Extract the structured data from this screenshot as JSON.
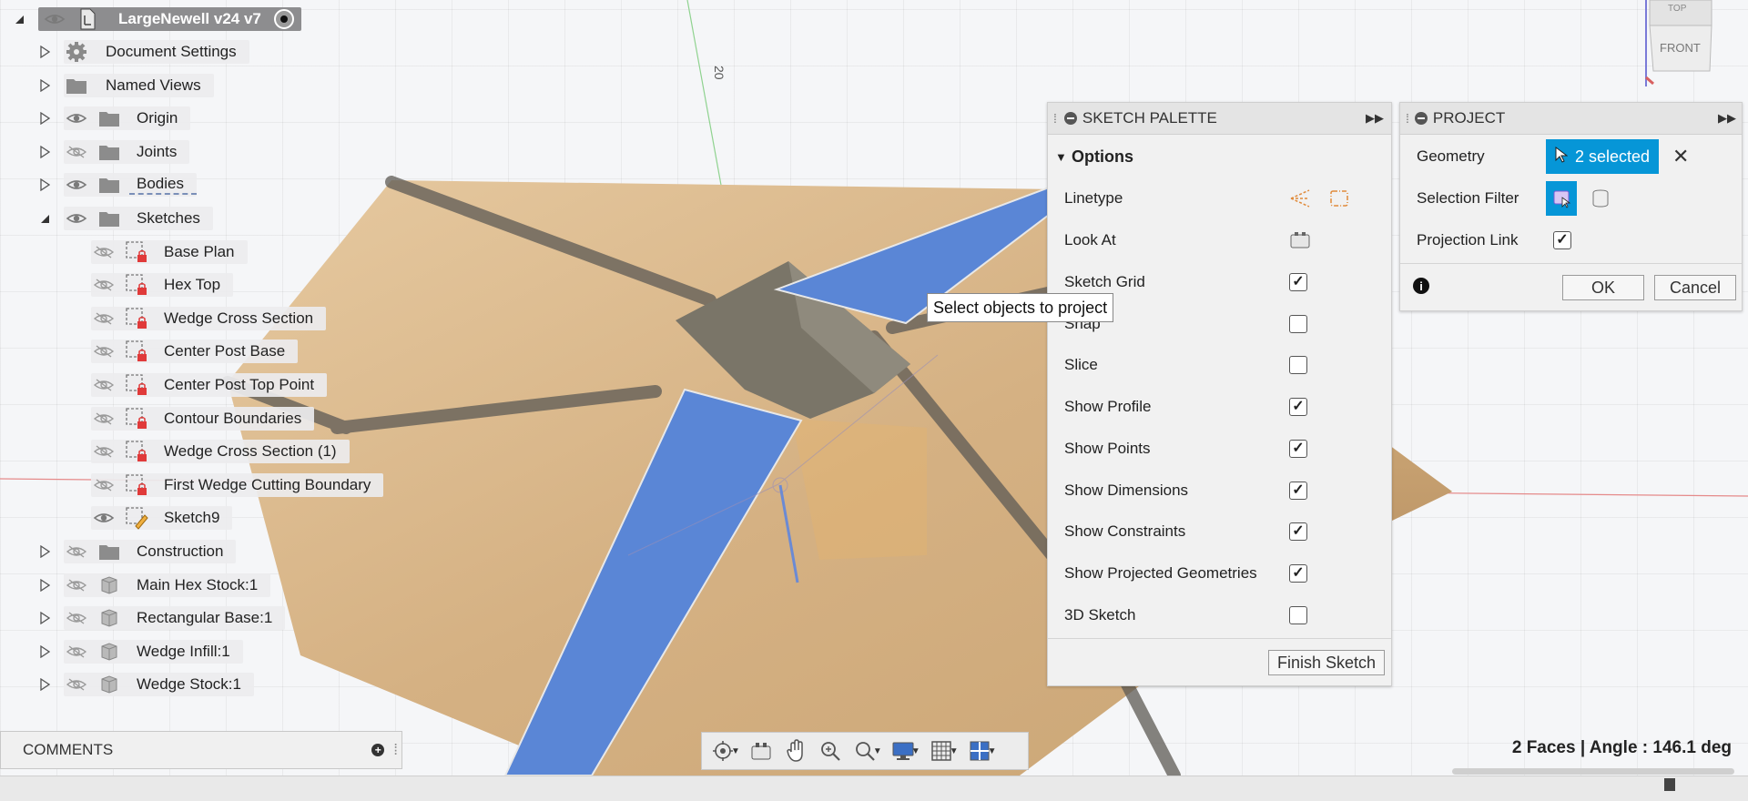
{
  "browser": {
    "root": {
      "label": "LargeNewell v24 v7"
    },
    "items": [
      {
        "label": "Document Settings",
        "icon": "gear-icon",
        "eye": "none",
        "expand": "collapsed"
      },
      {
        "label": "Named Views",
        "icon": "folder-icon",
        "eye": "none",
        "expand": "collapsed"
      },
      {
        "label": "Origin",
        "icon": "folder-icon",
        "eye": "visible",
        "expand": "collapsed"
      },
      {
        "label": "Joints",
        "icon": "folder-icon",
        "eye": "hidden",
        "expand": "collapsed"
      },
      {
        "label": "Bodies",
        "icon": "folder-icon",
        "eye": "visible",
        "expand": "collapsed"
      },
      {
        "label": "Sketches",
        "icon": "folder-icon",
        "eye": "visible",
        "expand": "expanded"
      },
      {
        "label": "Base Plan",
        "icon": "sketch-locked-icon",
        "eye": "hidden",
        "expand": "none"
      },
      {
        "label": "Hex Top",
        "icon": "sketch-locked-icon",
        "eye": "hidden",
        "expand": "none"
      },
      {
        "label": "Wedge Cross Section",
        "icon": "sketch-locked-icon",
        "eye": "hidden",
        "expand": "none"
      },
      {
        "label": "Center Post Base",
        "icon": "sketch-locked-icon",
        "eye": "hidden",
        "expand": "none"
      },
      {
        "label": "Center Post Top Point",
        "icon": "sketch-locked-icon",
        "eye": "hidden",
        "expand": "none"
      },
      {
        "label": "Contour Boundaries",
        "icon": "sketch-locked-icon",
        "eye": "hidden",
        "expand": "none"
      },
      {
        "label": "Wedge Cross Section (1)",
        "icon": "sketch-locked-icon",
        "eye": "hidden",
        "expand": "none"
      },
      {
        "label": "First Wedge Cutting Boundary",
        "icon": "sketch-locked-icon",
        "eye": "hidden",
        "expand": "none"
      },
      {
        "label": "Sketch9",
        "icon": "sketch-edit-icon",
        "eye": "visible",
        "expand": "none"
      },
      {
        "label": "Construction",
        "icon": "folder-icon",
        "eye": "hidden",
        "expand": "collapsed"
      },
      {
        "label": "Main Hex Stock:1",
        "icon": "component-icon",
        "eye": "hidden",
        "expand": "collapsed"
      },
      {
        "label": "Rectangular Base:1",
        "icon": "component-icon",
        "eye": "hidden",
        "expand": "collapsed"
      },
      {
        "label": "Wedge Infill:1",
        "icon": "component-icon",
        "eye": "hidden",
        "expand": "collapsed"
      },
      {
        "label": "Wedge Stock:1",
        "icon": "component-icon",
        "eye": "hidden",
        "expand": "collapsed"
      }
    ]
  },
  "viewcube": {
    "face_front": "FRONT",
    "face_top": "TOP"
  },
  "sketch_palette": {
    "title": "SKETCH PALETTE",
    "section": "Options",
    "linetype_label": "Linetype",
    "lookat_label": "Look At",
    "options": [
      {
        "label": "Sketch Grid",
        "checked": true
      },
      {
        "label": "Snap",
        "checked": false
      },
      {
        "label": "Slice",
        "checked": false
      },
      {
        "label": "Show Profile",
        "checked": true
      },
      {
        "label": "Show Points",
        "checked": true
      },
      {
        "label": "Show Dimensions",
        "checked": true
      },
      {
        "label": "Show Constraints",
        "checked": true
      },
      {
        "label": "Show Projected Geometries",
        "checked": true
      },
      {
        "label": "3D Sketch",
        "checked": false
      }
    ],
    "finish_label": "Finish Sketch"
  },
  "project": {
    "title": "PROJECT",
    "geometry_label": "Geometry",
    "geometry_value": "2 selected",
    "filter_label": "Selection Filter",
    "link_label": "Projection Link",
    "link_checked": true,
    "ok_label": "OK",
    "cancel_label": "Cancel"
  },
  "tooltip": "Select objects to project",
  "dimension_text": "20",
  "comments": {
    "label": "COMMENTS"
  },
  "status": "2 Faces | Angle : 146.1 deg",
  "colors": {
    "accent": "#0696d7",
    "wood": "#d9b98d",
    "selected_face": "#5a86d6",
    "post": "#7a7568"
  }
}
